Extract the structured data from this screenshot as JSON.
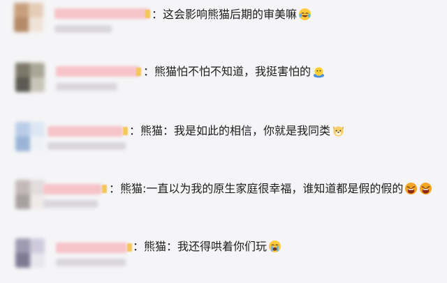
{
  "comments": [
    {
      "text": "：这会影响熊猫后期的审美嘛",
      "emoji": "laughing-tears-emoji",
      "avatar_colors": [
        "#c8a07d",
        "#e4cdb8",
        "#b58a68",
        "#efe3d8"
      ]
    },
    {
      "text": "：熊猫怕不怕不知道，我挺害怕的",
      "emoji": "chick-emoji",
      "avatar_colors": [
        "#7d7869",
        "#a9a696",
        "#5c5a52",
        "#c8c5b8"
      ]
    },
    {
      "text": "：熊猫：我是如此的相信，你就是我同类",
      "emoji": "dog-emoji",
      "avatar_colors": [
        "#b9cde8",
        "#dde7f3",
        "#9bb4d6",
        "#eef2f8"
      ]
    },
    {
      "text": "：熊猫:一直以为我的原生家庭很幸福，谁知道都是假的假的",
      "emoji": "scream-emoji",
      "avatar_colors": [
        "#c4b9b9",
        "#e2dcdc",
        "#a8a0a0",
        "#efe9e9"
      ]
    },
    {
      "text": "：熊猫：我还得哄着你们玩",
      "emoji": "crying-emoji",
      "avatar_colors": [
        "#9e9ab1",
        "#cfcbdc",
        "#7f7a94",
        "#e7e5ee"
      ]
    }
  ],
  "colors": {
    "background": "#f5f5f7",
    "name_blur": "#f6c3c8",
    "text": "#1c1c1c",
    "badge": "#f4c75b"
  }
}
